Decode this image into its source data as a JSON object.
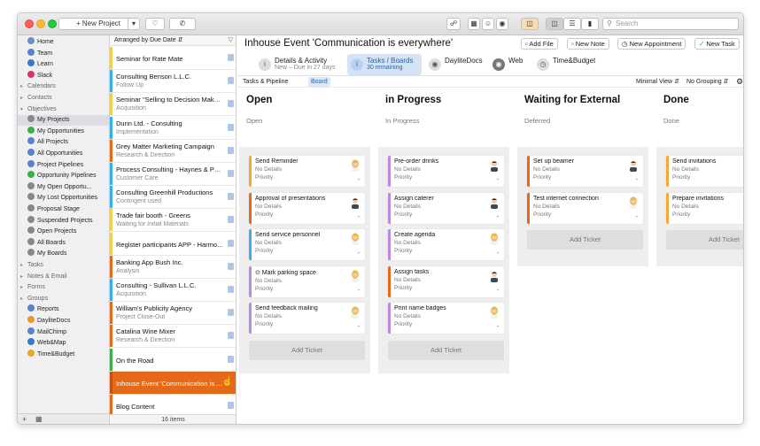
{
  "toolbar": {
    "new_project": "New Project",
    "search_placeholder": "Search"
  },
  "sidebar": {
    "items": [
      {
        "label": "Home",
        "type": "item",
        "icon": "home-icon",
        "color": "#6b8fc0"
      },
      {
        "label": "Team",
        "type": "item",
        "icon": "team-icon",
        "color": "#5a82c8"
      },
      {
        "label": "Learn",
        "type": "item",
        "icon": "learn-icon",
        "color": "#3a78c8"
      },
      {
        "label": "Slack",
        "type": "item",
        "icon": "slack-icon",
        "color": "#d13a68"
      },
      {
        "label": "Calendars",
        "type": "group"
      },
      {
        "label": "Contacts",
        "type": "group"
      },
      {
        "label": "Objectives",
        "type": "group"
      },
      {
        "label": "My Projects",
        "type": "item",
        "icon": "projects-icon",
        "color": "#888888",
        "selected": true
      },
      {
        "label": "My Opportunities",
        "type": "item",
        "icon": "opportunities-icon",
        "color": "#3fae49"
      },
      {
        "label": "All Projects",
        "type": "item",
        "icon": "projects-icon",
        "color": "#5a82c8"
      },
      {
        "label": "All Opportunities",
        "type": "item",
        "icon": "opportunities-icon",
        "color": "#5a82c8"
      },
      {
        "label": "Project Pipelines",
        "type": "item",
        "icon": "pipeline-icon",
        "color": "#5a82c8"
      },
      {
        "label": "Opportunity Pipelines",
        "type": "item",
        "icon": "pipeline-icon",
        "color": "#3fae49"
      },
      {
        "label": "My Open Opportu...",
        "type": "item",
        "icon": "filter-icon",
        "color": "#888888"
      },
      {
        "label": "My Lost Opportunities",
        "type": "item",
        "icon": "filter-icon",
        "color": "#888888"
      },
      {
        "label": "Proposal Stage",
        "type": "item",
        "icon": "filter-icon",
        "color": "#888888"
      },
      {
        "label": "Suspended Projects",
        "type": "item",
        "icon": "filter-icon",
        "color": "#888888"
      },
      {
        "label": "Open Projects",
        "type": "item",
        "icon": "filter-icon",
        "color": "#888888"
      },
      {
        "label": "All Boards",
        "type": "item",
        "icon": "filter-icon",
        "color": "#888888"
      },
      {
        "label": "My Boards",
        "type": "item",
        "icon": "filter-icon",
        "color": "#888888"
      },
      {
        "label": "Tasks",
        "type": "group"
      },
      {
        "label": "Notes & Email",
        "type": "group"
      },
      {
        "label": "Forms",
        "type": "group"
      },
      {
        "label": "Groups",
        "type": "group"
      },
      {
        "label": "Reports",
        "type": "item",
        "icon": "reports-icon",
        "color": "#5a82c8"
      },
      {
        "label": "DayliteDocs",
        "type": "item",
        "icon": "daylitedocs-icon",
        "color": "#e89a2a"
      },
      {
        "label": "MailChimp",
        "type": "item",
        "icon": "mailchimp-icon",
        "color": "#5a82c8"
      },
      {
        "label": "Web&Map",
        "type": "item",
        "icon": "web-icon",
        "color": "#3a78c8"
      },
      {
        "label": "Time&Budget",
        "type": "item",
        "icon": "time-icon",
        "color": "#e8a62a"
      }
    ]
  },
  "list": {
    "sort_label": "Arranged by Due Date",
    "count_label": "16 items",
    "items": [
      {
        "title": "Seminar for Rate Mate",
        "sub": "",
        "color": "#f2d14a"
      },
      {
        "title": "Consulting Benson L.L.C.",
        "sub": "Follow Up",
        "color": "#3aaeea"
      },
      {
        "title": "Seminar \"Selling to Decision Maker...",
        "sub": "Acquisition",
        "color": "#f2d14a"
      },
      {
        "title": "Dunn Ltd. - Consulting",
        "sub": "Implementation",
        "color": "#3aaeea"
      },
      {
        "title": "Grey Matter Marketing Campaign",
        "sub": "Research & Direction",
        "color": "#e46a1a"
      },
      {
        "title": "Process Consulting - Haynes & Par...",
        "sub": "Customer Care",
        "color": "#3aaeea"
      },
      {
        "title": "Consulting Greenhill Productions",
        "sub": "Contingent used",
        "color": "#3aaeea"
      },
      {
        "title": "Trade fair booth - Greens",
        "sub": "Waiting for Initial Materials",
        "color": "#f2d14a"
      },
      {
        "title": "Register participants APP - Harmo...",
        "sub": "",
        "color": "#f2d14a"
      },
      {
        "title": "Banking App Bush Inc.",
        "sub": "Analysis",
        "color": "#e46a1a"
      },
      {
        "title": "Consulting - Sullivan L.L.C.",
        "sub": "Acquisition",
        "color": "#3aaeea"
      },
      {
        "title": "William's Publicity Agency",
        "sub": "Project Close-Out",
        "color": "#e46a1a"
      },
      {
        "title": "Catalina Wine Mixer",
        "sub": "Research & Direction",
        "color": "#e46a1a"
      },
      {
        "title": "On the Road",
        "sub": "",
        "color": "#3fae49"
      },
      {
        "title": "Inhouse Event 'Communication is e...",
        "sub": "",
        "color": "#e46a1a",
        "active": true
      },
      {
        "title": "Blog Content",
        "sub": "",
        "color": "#e46a1a"
      }
    ]
  },
  "main": {
    "title": "Inhouse Event 'Communication is everywhere'",
    "actions": {
      "add_file": "Add File",
      "new_note": "New Note",
      "new_appointment": "New Appointment",
      "new_task": "New Task",
      "more": "•••"
    },
    "tabs": [
      {
        "label": "Details & Activity",
        "sub": "New – Due in 27 days",
        "icon": "info-icon"
      },
      {
        "label": "Tasks / Boards",
        "sub": "30 remaining",
        "icon": "info-icon",
        "selected": true
      },
      {
        "label": "DayliteDocs",
        "sub": "",
        "icon": "daylitedocs-icon"
      },
      {
        "label": "Web",
        "sub": "",
        "icon": "web-icon"
      },
      {
        "label": "Time&Budget",
        "sub": "",
        "icon": "clock-icon"
      }
    ],
    "subtabs": {
      "tasks_pipeline": "Tasks & Pipeline",
      "board": "Board",
      "minimal_view": "Minimal View",
      "no_grouping": "No Grouping"
    }
  },
  "board": {
    "detail_label": "No Details",
    "priority_label": "Priority",
    "dash": "-",
    "add_ticket": "Add Ticket",
    "columns": [
      {
        "title": "Open",
        "sub": "Open",
        "cards": [
          {
            "title": "Send Reminder",
            "color": "#f2a93a",
            "avatar": "female"
          },
          {
            "title": "Approval of presentations",
            "color": "#e46a1a",
            "avatar": "male"
          },
          {
            "title": "Send service personnel",
            "color": "#3aaeea",
            "avatar": "female"
          },
          {
            "title": "⊙ Mark parking space",
            "color": "#b98ae0",
            "avatar": "female"
          },
          {
            "title": "Send feedback mailing",
            "color": "#b98ae0",
            "avatar": "female"
          }
        ]
      },
      {
        "title": "in Progress",
        "sub": "In Progress",
        "cards": [
          {
            "title": "Pre-order drinks",
            "color": "#b98ae0",
            "avatar": "male"
          },
          {
            "title": "Assign caterer",
            "color": "#b98ae0",
            "avatar": "male"
          },
          {
            "title": "Create agenda",
            "color": "#b98ae0",
            "avatar": "female"
          },
          {
            "title": "Assign tasks",
            "color": "#e46a1a",
            "avatar": "male"
          },
          {
            "title": "Print name badges",
            "color": "#b98ae0",
            "avatar": "female"
          }
        ]
      },
      {
        "title": "Waiting for External",
        "sub": "Deferred",
        "cards": [
          {
            "title": "Set up beamer",
            "color": "#e46a1a",
            "avatar": "male"
          },
          {
            "title": "Test internet connection",
            "color": "#e46a1a",
            "avatar": "female"
          }
        ]
      },
      {
        "title": "Done",
        "sub": "Done",
        "cards": [
          {
            "title": "Send invitations",
            "color": "#f2a93a",
            "avatar": "female"
          },
          {
            "title": "Prepare invitations",
            "color": "#f2a93a",
            "avatar": "female"
          }
        ]
      }
    ]
  }
}
